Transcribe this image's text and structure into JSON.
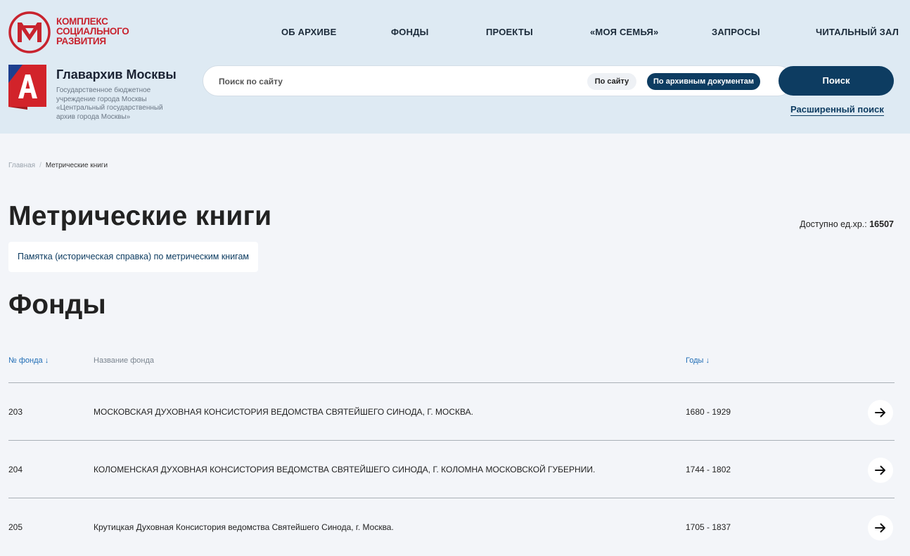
{
  "header": {
    "complex_logo_text": [
      "КОМПЛЕКС",
      "СОЦИАЛЬНОГО",
      "РАЗВИТИЯ"
    ],
    "nav": [
      {
        "label": "ОБ АРХИВЕ"
      },
      {
        "label": "ФОНДЫ"
      },
      {
        "label": "ПРОЕКТЫ"
      },
      {
        "label": "«МОЯ СЕМЬЯ»"
      },
      {
        "label": "ЗАПРОСЫ"
      },
      {
        "label": "ЧИТАЛЬНЫЙ ЗАЛ"
      }
    ],
    "archive_name": "Главархив Москвы",
    "archive_description": "Государственное бюджетное учреждение города Москвы «Центральный государственный архив города Москвы»",
    "colors": {
      "brand_red": "#c8232e",
      "brand_navy": "#0d3c61",
      "header_bg": "#deeaf3"
    }
  },
  "search": {
    "placeholder": "Поиск по сайту",
    "scope_site": "По сайту",
    "scope_docs": "По архивным документам",
    "button": "Поиск",
    "advanced": "Расширенный поиск"
  },
  "breadcrumb": {
    "home": "Главная",
    "separator": "/",
    "current": "Метрические книги"
  },
  "page": {
    "title": "Метрические книги",
    "available_label": "Доступно ед.хр.:",
    "available_count": "16507",
    "memo_link": "Памятка (историческая справка) по метрическим книгам",
    "section_title": "Фонды"
  },
  "table": {
    "headers": {
      "num": "№ фонда ↓",
      "name": "Название фонда",
      "years": "Годы ↓"
    },
    "rows": [
      {
        "num": "203",
        "name": "МОСКОВСКАЯ ДУХОВНАЯ КОНСИСТОРИЯ ВЕДОМСТВА СВЯТЕЙШЕГО СИНОДА, Г. МОСКВА.",
        "years": "1680 - 1929",
        "icon": "arrow-right-icon"
      },
      {
        "num": "204",
        "name": "КОЛОМЕНСКАЯ ДУХОВНАЯ КОНСИСТОРИЯ ВЕДОМСТВА СВЯТЕЙШЕГО СИНОДА, Г. КОЛОМНА МОСКОВСКОЙ ГУБЕРНИИ.",
        "years": "1744 - 1802",
        "icon": "arrow-right-icon"
      },
      {
        "num": "205",
        "name": "Крутицкая Духовная Консистория ведомства Святейшего Синода, г. Москва.",
        "years": "1705 - 1837",
        "icon": "arrow-right-icon"
      }
    ]
  }
}
